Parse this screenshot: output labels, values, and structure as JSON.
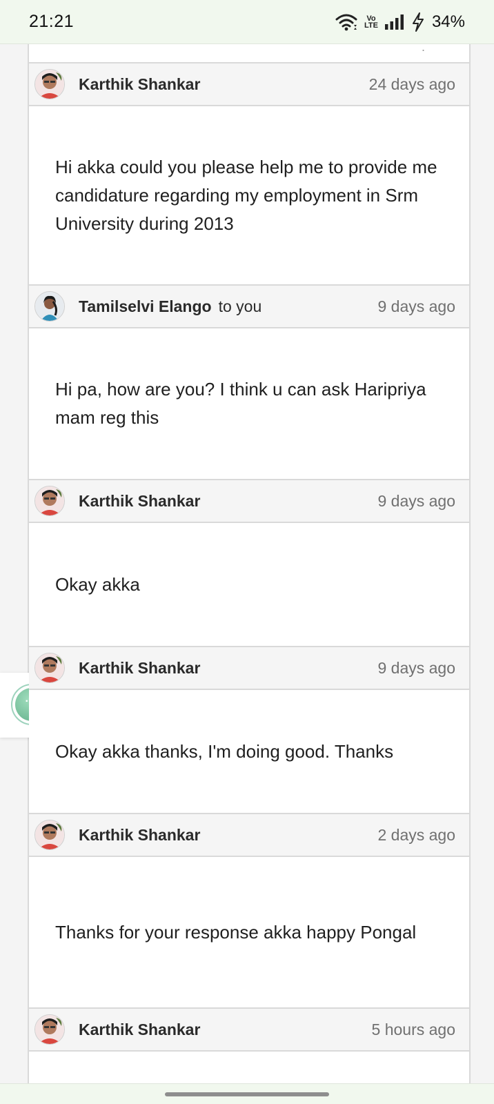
{
  "status_bar": {
    "time": "21:21",
    "volte_label": "Vo LTE",
    "battery": "34%",
    "icons": [
      "wifi-icon",
      "volte-icon",
      "signal-icon",
      "charging-icon"
    ]
  },
  "thread": {
    "messages": [
      {
        "sender": "Karthik Shankar",
        "recipient": "",
        "time": "24 days ago",
        "avatar": "avatar-karthik",
        "body": "Hi akka could you please help me to provide me candidature regarding my employment in Srm University during 2013"
      },
      {
        "sender": "Tamilselvi Elango",
        "recipient": "to you",
        "time": "9 days ago",
        "avatar": "avatar-tamilselvi",
        "body": "Hi pa, how are you? I think u can ask Haripriya mam reg this"
      },
      {
        "sender": "Karthik Shankar",
        "recipient": "",
        "time": "9 days ago",
        "avatar": "avatar-karthik",
        "body": "Okay akka"
      },
      {
        "sender": "Karthik Shankar",
        "recipient": "",
        "time": "9 days ago",
        "avatar": "avatar-karthik",
        "body": "Okay akka thanks, I'm doing good. Thanks"
      },
      {
        "sender": "Karthik Shankar",
        "recipient": "",
        "time": "2 days ago",
        "avatar": "avatar-karthik",
        "body": "Thanks for your response akka happy Pongal"
      },
      {
        "sender": "Karthik Shankar",
        "recipient": "",
        "time": "5 hours ago",
        "avatar": "avatar-karthik",
        "body": ""
      }
    ]
  },
  "floating_button": {
    "icon": "more-dots-icon",
    "glyph": "···"
  },
  "colors": {
    "system_bar_bg": "#f1f8ee",
    "header_bg": "#f5f5f5",
    "border": "#d9d9d9",
    "timestamp": "#707070",
    "fab_green": "#5fae88"
  }
}
